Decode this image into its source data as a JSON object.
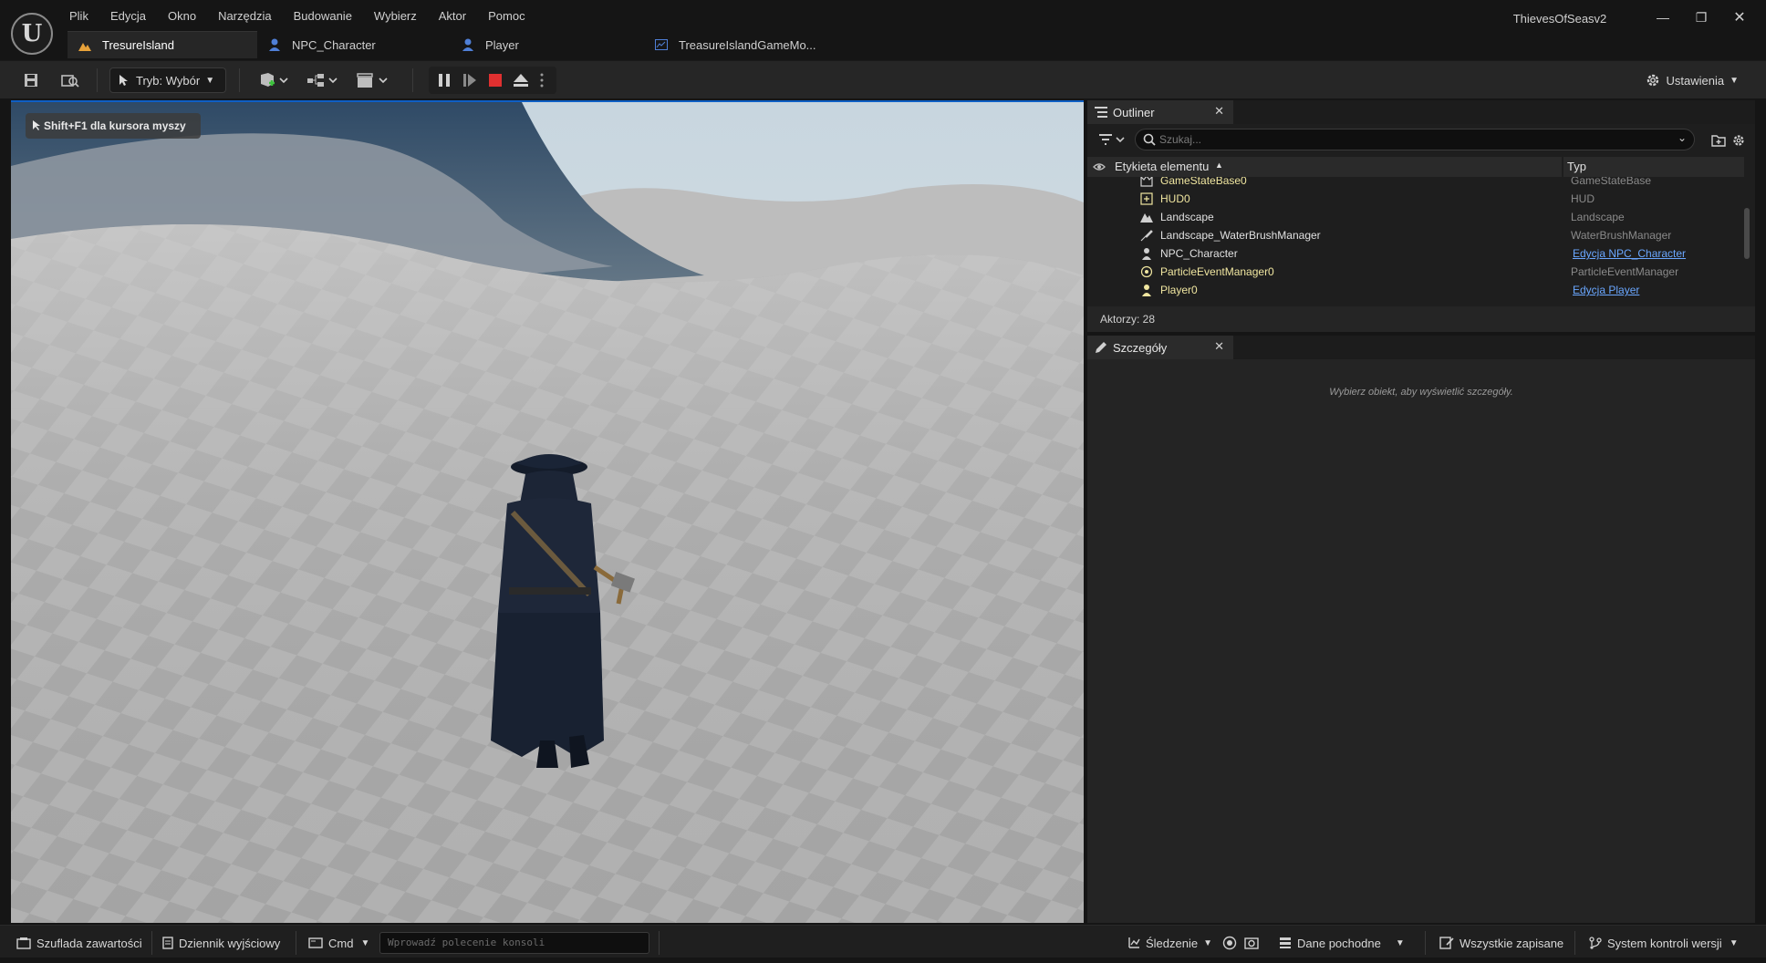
{
  "menu": [
    "Plik",
    "Edycja",
    "Okno",
    "Narzędzia",
    "Budowanie",
    "Wybierz",
    "Aktor",
    "Pomoc"
  ],
  "app_title": "ThievesOfSeasv2",
  "tabs": [
    {
      "label": "TresureIsland",
      "icon": "level-icon"
    },
    {
      "label": "NPC_Character",
      "icon": "character-blueprint-icon"
    },
    {
      "label": "Player",
      "icon": "character-blueprint-icon"
    },
    {
      "label": "TreasureIslandGameMo...",
      "icon": "blueprint-icon"
    }
  ],
  "toolbar": {
    "mode_label": "Tryb: Wybór",
    "settings_label": "Ustawienia"
  },
  "viewport": {
    "hint": "Shift+F1 dla kursora myszy"
  },
  "outliner": {
    "title": "Outliner",
    "search_placeholder": "Szukaj...",
    "col_label": "Etykieta elementu",
    "col_type": "Typ",
    "rows": [
      {
        "label": "GameStateBase0",
        "type": "GameStateBase",
        "icon": "game-state-icon",
        "actor": true,
        "link": false
      },
      {
        "label": "HUD0",
        "type": "HUD",
        "icon": "hud-icon",
        "actor": true,
        "link": false
      },
      {
        "label": "Landscape",
        "type": "Landscape",
        "icon": "landscape-icon",
        "actor": false,
        "link": false
      },
      {
        "label": "Landscape_WaterBrushManager",
        "type": "WaterBrushManager",
        "icon": "brush-icon",
        "actor": false,
        "link": false
      },
      {
        "label": "NPC_Character",
        "type": "Edycja NPC_Character",
        "icon": "character-icon",
        "actor": false,
        "link": true
      },
      {
        "label": "ParticleEventManager0",
        "type": "ParticleEventManager",
        "icon": "particle-icon",
        "actor": true,
        "link": false
      },
      {
        "label": "Player0",
        "type": "Edycja Player",
        "icon": "character-icon",
        "actor": true,
        "link": true
      }
    ],
    "actor_count": "Aktorzy: 28"
  },
  "details": {
    "title": "Szczegóły",
    "empty_text": "Wybierz obiekt, aby wyświetlić szczegóły."
  },
  "statusbar": {
    "content_drawer": "Szuflada zawartości",
    "output_log": "Dziennik wyjściowy",
    "cmd": "Cmd",
    "console_placeholder": "Wprowadź polecenie konsoli",
    "trace": "Śledzenie",
    "derived_data": "Dane pochodne",
    "all_saved": "Wszystkie zapisane",
    "source_control": "System kontroli wersji"
  },
  "colors": {
    "accent": "#0e5fc4",
    "link": "#6aa7ff",
    "stop": "#e03030",
    "actor_text": "#f0e6a0"
  }
}
